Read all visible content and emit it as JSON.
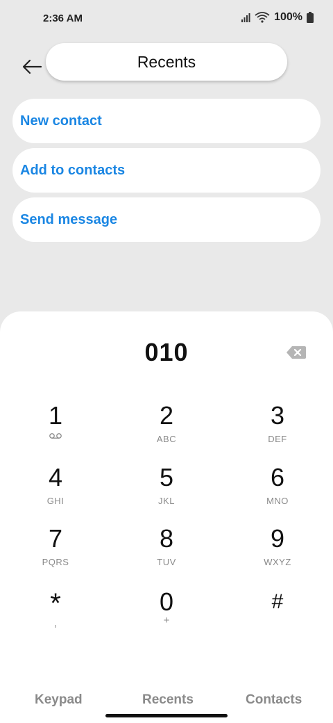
{
  "status": {
    "time": "2:36 AM",
    "battery": "100%"
  },
  "header": {
    "title": "Recents"
  },
  "actions": [
    {
      "label": "New contact"
    },
    {
      "label": "Add to contacts"
    },
    {
      "label": "Send message"
    }
  ],
  "dialer": {
    "number": "010",
    "keys": [
      {
        "digit": "1",
        "sub": ""
      },
      {
        "digit": "2",
        "sub": "ABC"
      },
      {
        "digit": "3",
        "sub": "DEF"
      },
      {
        "digit": "4",
        "sub": "GHI"
      },
      {
        "digit": "5",
        "sub": "JKL"
      },
      {
        "digit": "6",
        "sub": "MNO"
      },
      {
        "digit": "7",
        "sub": "PQRS"
      },
      {
        "digit": "8",
        "sub": "TUV"
      },
      {
        "digit": "9",
        "sub": "WXYZ"
      },
      {
        "digit": "*",
        "sub": ","
      },
      {
        "digit": "0",
        "sub": "+"
      },
      {
        "digit": "#",
        "sub": ""
      }
    ]
  },
  "tabs": [
    {
      "label": "Keypad"
    },
    {
      "label": "Recents"
    },
    {
      "label": "Contacts"
    }
  ],
  "colors": {
    "accent": "#1a86e3",
    "background": "#e9e9e9"
  }
}
